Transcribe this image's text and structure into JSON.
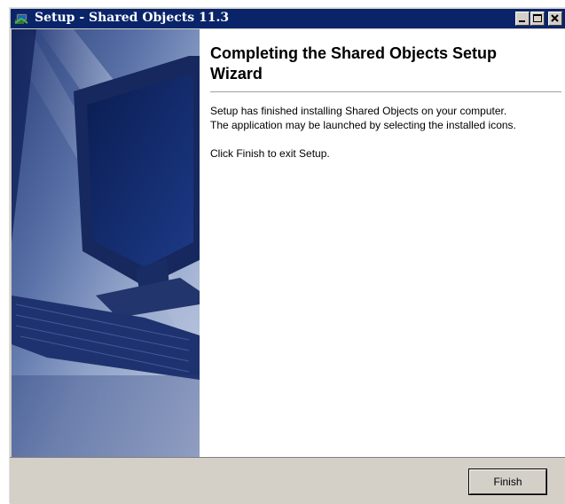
{
  "window": {
    "title": "Setup - Shared Objects 11.3",
    "icon": "setup-wizard-icon",
    "controls": [
      "minimize-icon",
      "maximize-icon",
      "close-icon"
    ]
  },
  "content": {
    "heading_line1": "Completing the Shared Objects Setup",
    "heading_line2": "Wizard",
    "paragraph1_line1": "Setup has finished installing Shared Objects on your computer.",
    "paragraph1_line2": "The application may be launched by selecting the installed icons.",
    "paragraph2": "Click Finish to exit Setup."
  },
  "buttons": {
    "finish": "Finish"
  },
  "colors": {
    "titlebar": "#0a246a",
    "panel_dark": "#0b1e58",
    "panel_light": "#b9c4dc",
    "dialog_face": "#d4d0c8"
  }
}
